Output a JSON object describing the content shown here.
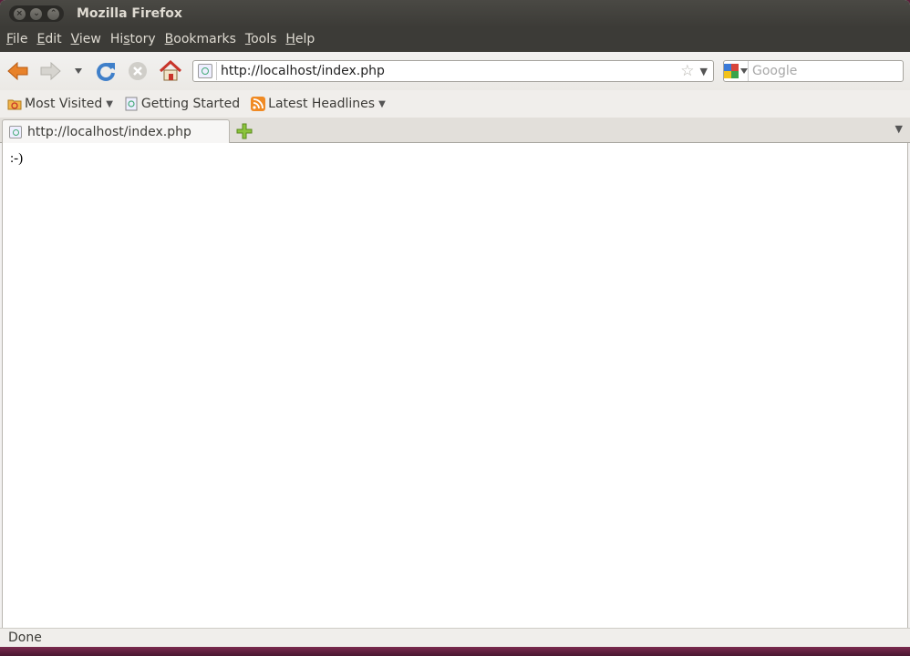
{
  "window": {
    "title": "Mozilla Firefox"
  },
  "menu": [
    {
      "pre": "",
      "u": "F",
      "post": "ile"
    },
    {
      "pre": "",
      "u": "E",
      "post": "dit"
    },
    {
      "pre": "",
      "u": "V",
      "post": "iew"
    },
    {
      "pre": "Hi",
      "u": "s",
      "post": "tory"
    },
    {
      "pre": "",
      "u": "B",
      "post": "ookmarks"
    },
    {
      "pre": "",
      "u": "T",
      "post": "ools"
    },
    {
      "pre": "",
      "u": "H",
      "post": "elp"
    }
  ],
  "navbar": {
    "url": "http://localhost/index.php",
    "search_placeholder": "Google"
  },
  "bookmarks": {
    "most_visited": "Most Visited",
    "getting_started": "Getting Started",
    "latest_headlines": "Latest Headlines"
  },
  "tabs": [
    {
      "label": "http://localhost/index.php"
    }
  ],
  "page": {
    "text": ":-)"
  },
  "status": {
    "text": "Done"
  },
  "colors": {
    "titlebar": "#3c3b37",
    "back_arrow": "#e8822a",
    "reload": "#3f7fc9",
    "home": "#c8342a"
  },
  "icons": {
    "close": "close-icon",
    "minimize": "minimize-icon",
    "maximize": "maximize-icon",
    "back": "back-arrow-icon",
    "forward": "forward-arrow-icon",
    "reload": "reload-icon",
    "stop": "stop-icon",
    "home": "home-icon",
    "bookmark_star": "star-icon",
    "search": "magnifier-icon",
    "rss": "rss-icon",
    "new_tab": "plus-icon"
  }
}
